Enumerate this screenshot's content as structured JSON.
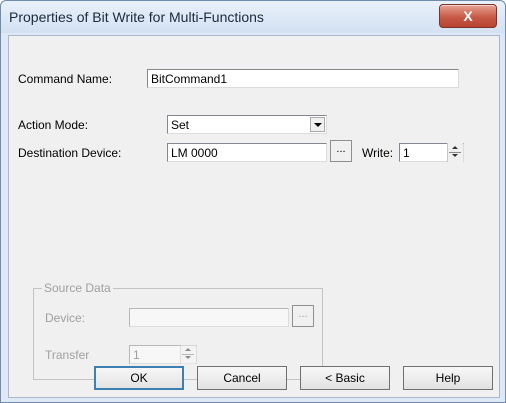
{
  "window": {
    "title": "Properties of Bit Write for Multi-Functions",
    "close_label": "X"
  },
  "command_name": {
    "label": "Command Name:",
    "value": "BitCommand1"
  },
  "action_mode": {
    "label": "Action Mode:",
    "value": "Set"
  },
  "destination_device": {
    "label": "Destination Device:",
    "value": "LM 0000",
    "browse_label": "..."
  },
  "write": {
    "label": "Write:",
    "value": "1"
  },
  "source_data": {
    "title": "Source Data",
    "device_label": "Device:",
    "device_value": "",
    "browse_label": "...",
    "transfer_label": "Transfer",
    "transfer_value": "1"
  },
  "buttons": {
    "ok": "OK",
    "cancel": "Cancel",
    "basic": "< Basic",
    "help": "Help"
  }
}
